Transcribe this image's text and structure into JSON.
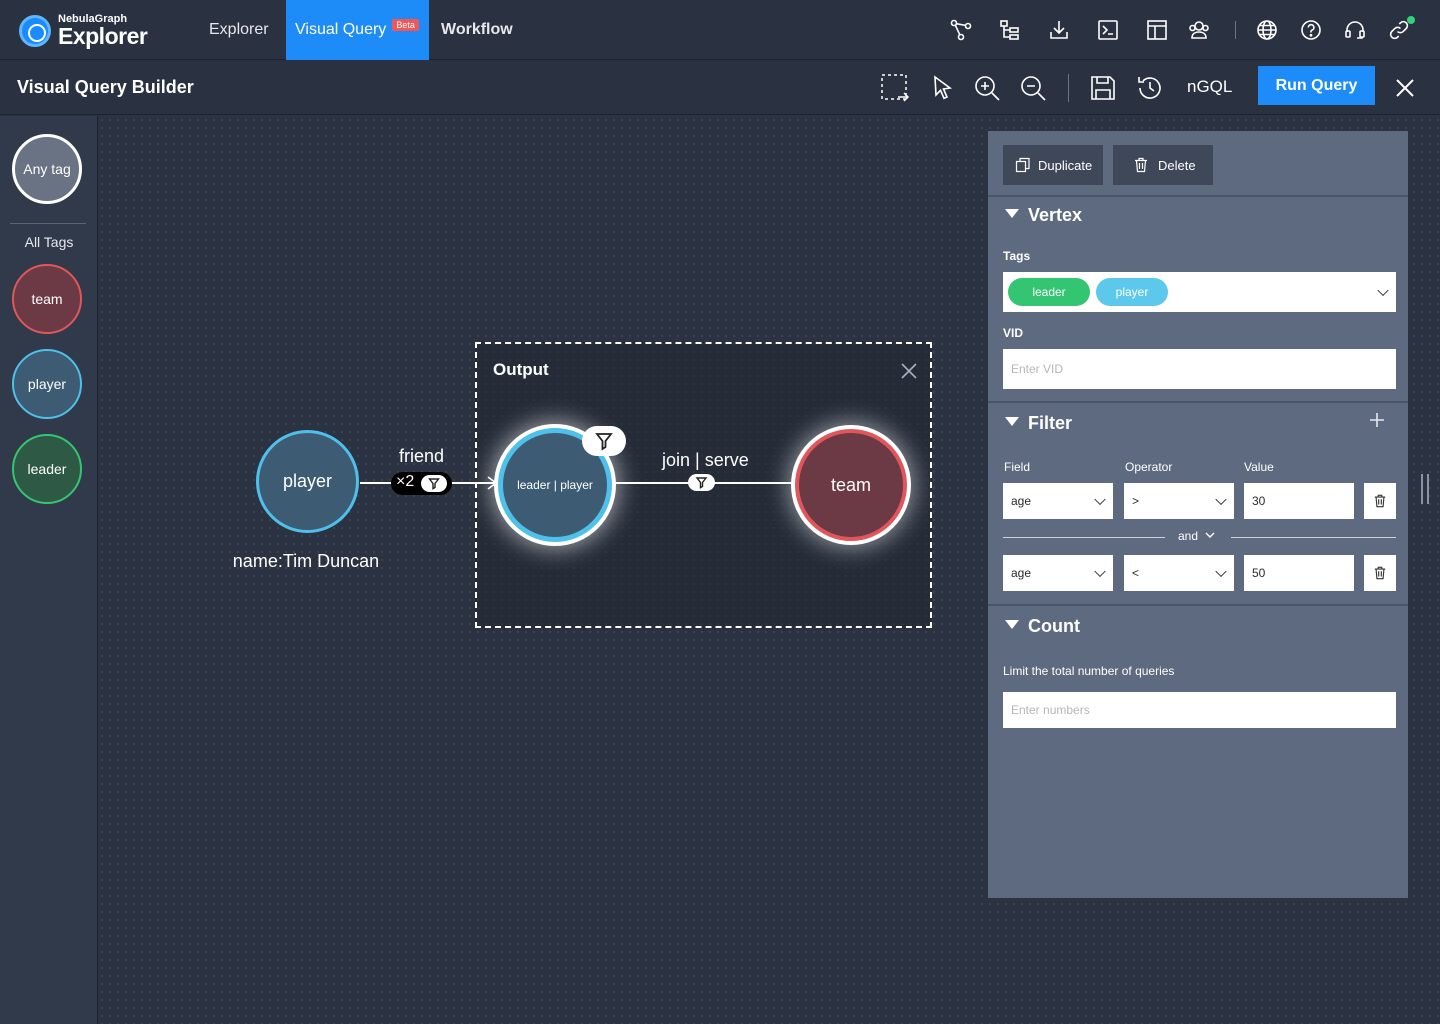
{
  "app": {
    "logo_sub": "NebulaGraph",
    "logo_main": "Explorer",
    "tabs": [
      {
        "label": "Explorer",
        "active": false
      },
      {
        "label": "Visual Query",
        "active": true,
        "badge": "Beta"
      },
      {
        "label": "Workflow",
        "active": false
      }
    ],
    "top_icons": [
      "schema-icon",
      "import-icon",
      "download-icon",
      "console-icon",
      "layout-icon",
      "users-icon",
      "language-icon",
      "help-icon",
      "support-icon",
      "connection-icon"
    ]
  },
  "toolbar": {
    "title": "Visual Query Builder",
    "ngql_label": "nGQL",
    "run_label": "Run Query",
    "icons": [
      "select-area-icon",
      "pointer-icon",
      "zoom-in-icon",
      "zoom-out-icon",
      "save-icon",
      "history-icon",
      "close-icon"
    ]
  },
  "sidebar": {
    "any_tag": "Any tag",
    "all_tags_label": "All Tags",
    "tags": [
      {
        "label": "team",
        "fill": "#6b3a44",
        "border": "#e0565b"
      },
      {
        "label": "player",
        "fill": "#3d5c74",
        "border": "#4ec0ea"
      },
      {
        "label": "leader",
        "fill": "#2e5a45",
        "border": "#34c572"
      }
    ]
  },
  "graph": {
    "start_node": {
      "label": "player",
      "caption": "name:Tim Duncan"
    },
    "edge1": {
      "label": "friend",
      "steps": "×2"
    },
    "output_box": {
      "title": "Output"
    },
    "mid_node": {
      "label": "leader | player"
    },
    "edge2": {
      "label": "join | serve"
    },
    "end_node": {
      "label": "team"
    }
  },
  "panel": {
    "duplicate_label": "Duplicate",
    "delete_label": "Delete",
    "vertex": {
      "heading": "Vertex",
      "tags_label": "Tags",
      "tags": [
        {
          "label": "leader",
          "color": "#34c572"
        },
        {
          "label": "player",
          "color": "#5cc8ec"
        }
      ],
      "vid_label": "VID",
      "vid_placeholder": "Enter VID"
    },
    "filter": {
      "heading": "Filter",
      "field_label": "Field",
      "operator_label": "Operator",
      "value_label": "Value",
      "rows": [
        {
          "field": "age",
          "operator": ">",
          "value": "30"
        },
        {
          "field": "age",
          "operator": "<",
          "value": "50"
        }
      ],
      "joiner": "and"
    },
    "count": {
      "heading": "Count",
      "hint": "Limit the total number of queries",
      "placeholder": "Enter numbers"
    }
  }
}
